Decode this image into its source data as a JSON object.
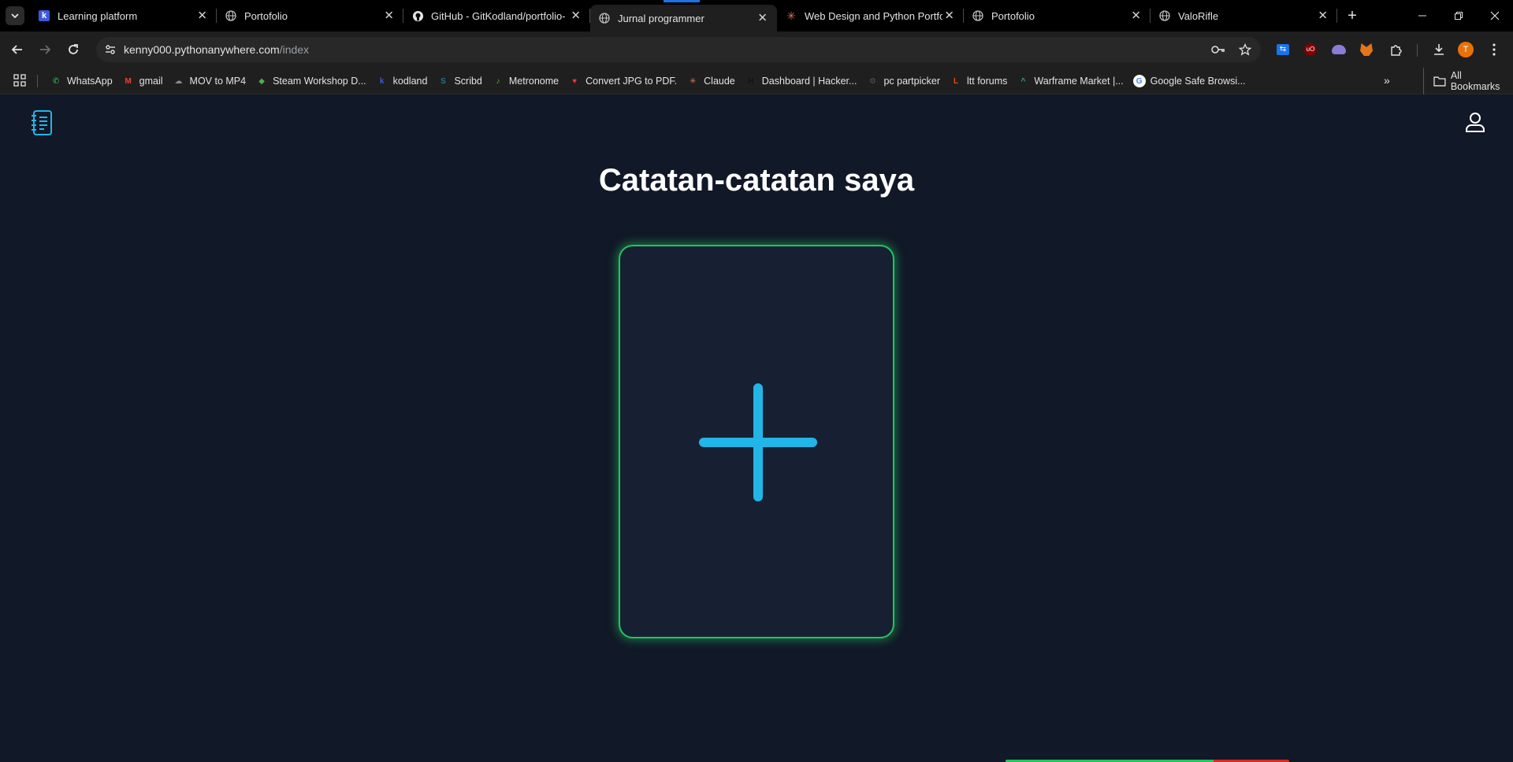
{
  "browser": {
    "tabs": [
      {
        "title": "Learning platform",
        "icon": "kodland-icon",
        "active": false
      },
      {
        "title": "Portofolio",
        "icon": "globe-icon",
        "active": false
      },
      {
        "title": "GitHub - GitKodland/portfolio-",
        "icon": "github-icon",
        "active": false
      },
      {
        "title": "Jurnal programmer",
        "icon": "globe-icon",
        "active": true
      },
      {
        "title": "Web Design and Python Portfol",
        "icon": "claude-icon",
        "active": false
      },
      {
        "title": "Portofolio",
        "icon": "globe-icon",
        "active": false
      },
      {
        "title": "ValoRifle",
        "icon": "globe-icon",
        "active": false
      }
    ],
    "address": {
      "host": "kenny000.pythonanywhere.com",
      "path": "/index"
    },
    "profile_initial": "T",
    "bookmarks": [
      {
        "label": "WhatsApp",
        "color": "#25d366",
        "glyph": "✆"
      },
      {
        "label": "gmail",
        "color": "#ea4335",
        "glyph": "M"
      },
      {
        "label": "MOV to MP4",
        "color": "#8a8a8a",
        "glyph": "☁"
      },
      {
        "label": "Steam Workshop D...",
        "color": "#4caf50",
        "glyph": "◆"
      },
      {
        "label": "kodland",
        "color": "#3b5bdb",
        "glyph": "k"
      },
      {
        "label": "Scribd",
        "color": "#1e7b85",
        "glyph": "S"
      },
      {
        "label": "Metronome",
        "color": "#6aa84f",
        "glyph": "♪"
      },
      {
        "label": "Convert JPG to PDF.",
        "color": "#e53935",
        "glyph": "♥"
      },
      {
        "label": "Claude",
        "color": "#d97757",
        "glyph": "✳"
      },
      {
        "label": "Dashboard | Hacker...",
        "color": "#111111",
        "glyph": "H"
      },
      {
        "label": "pc partpicker",
        "color": "#555555",
        "glyph": "⚙"
      },
      {
        "label": "ltt forums",
        "color": "#e65100",
        "glyph": "L"
      },
      {
        "label": "Warframe Market |...",
        "color": "#26a69a",
        "glyph": "^"
      },
      {
        "label": "Google Safe Browsi...",
        "color": "#ffffff",
        "glyph": "G"
      }
    ],
    "all_bookmarks_label": "All Bookmarks"
  },
  "page": {
    "title": "Catatan-catatan saya",
    "accent_green": "#22c55e",
    "accent_blue": "#22b5e8",
    "background": "#111827"
  }
}
